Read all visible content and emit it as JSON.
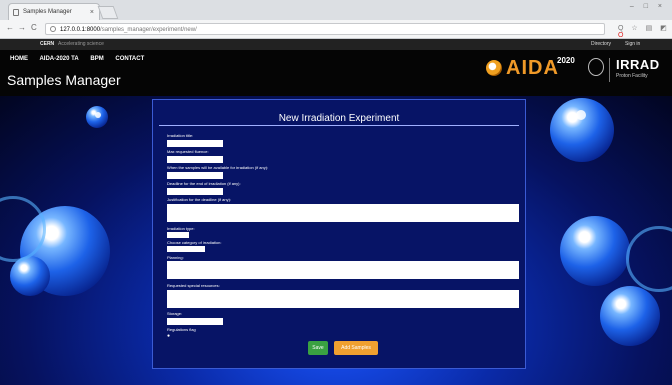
{
  "browser": {
    "tab_title": "Samples Manager",
    "tab_close": "×",
    "window_controls": "– □ ×",
    "back": "←",
    "forward": "→",
    "reload": "C",
    "url_host": "127.0.0.1:8000",
    "url_path": "/samples_manager/experiment/new/",
    "ext_icons": "Q ☆ ▤ ◩",
    "ext_red": "O"
  },
  "topbar": {
    "cern": "CERN",
    "accelerating": "Accelerating science",
    "directory": "Directory",
    "sign_in": "Sign in"
  },
  "nav": {
    "items": [
      "HOME",
      "AIDA-2020 TA",
      "BPM",
      "CONTACT"
    ]
  },
  "site": {
    "title": "Samples Manager",
    "aida_text": "AIDA",
    "aida_sup": "2020",
    "irrad_big": "IRRAD",
    "irrad_small": "Proton Facility"
  },
  "form": {
    "title": "New Irradiation Experiment",
    "labels": {
      "irradiation_title": "Irradiation title:",
      "max_fluence": "Max requested fluence:",
      "samples_available": "When the samples will be available for irradiation (if any):",
      "deadline": "Deadline for the end of irradiation (if any):",
      "justification": "Justification for the deadline (if any):",
      "irradiation_type": "Irradiation type:",
      "category": "Choose category of irradiation:",
      "planning": "Planning:",
      "special_resources": "Requested special resources:",
      "storage": "Storage:",
      "regulations": "Regulations flag"
    },
    "checkbox_glyph": "●",
    "buttons": {
      "save": "Save",
      "add_samples": "Add Samples"
    }
  }
}
